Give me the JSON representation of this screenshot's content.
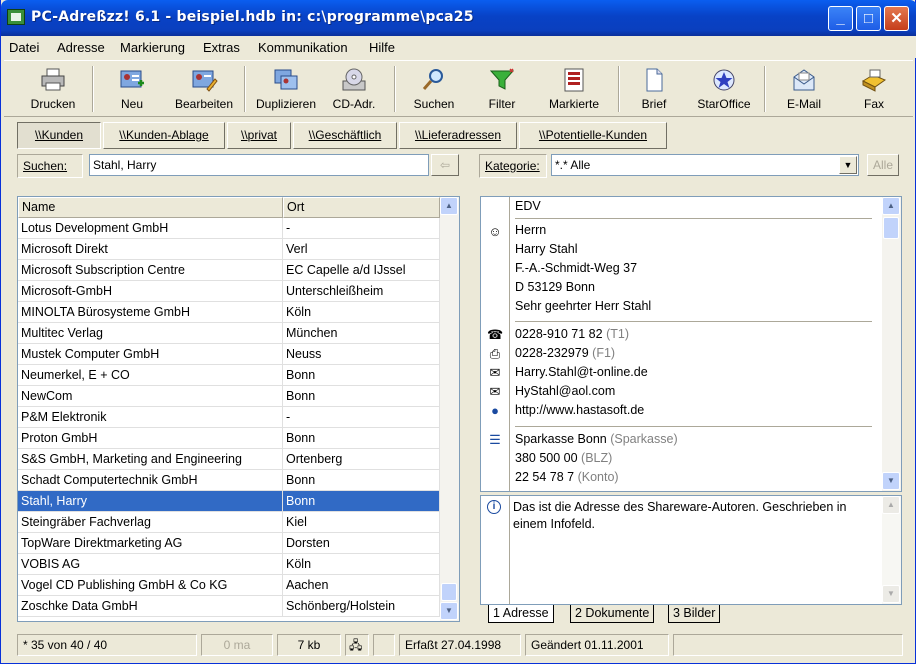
{
  "window": {
    "title": "PC-Adreßzz! 6.1 - beispiel.hdb in: c:\\programme\\pca25"
  },
  "menu": [
    "Datei",
    "Adresse",
    "Markierung",
    "Extras",
    "Kommunikation",
    "Hilfe"
  ],
  "toolbar": {
    "drucken": "Drucken",
    "neu": "Neu",
    "bearbeiten": "Bearbeiten",
    "duplizieren": "Duplizieren",
    "cdadr": "CD-Adr.",
    "suchen": "Suchen",
    "filter": "Filter",
    "markierte": "Markierte",
    "brief": "Brief",
    "staroffice": "StarOffice",
    "email": "E-Mail",
    "fax": "Fax"
  },
  "tabs": [
    "\\\\Kunden",
    "\\\\Kunden-Ablage",
    "\\\\privat",
    "\\\\Geschäftlich",
    "\\\\Lieferadressen",
    "\\\\Potentielle-Kunden"
  ],
  "search": {
    "label": "Suchen:",
    "value": "Stahl, Harry",
    "category_label": "Kategorie:",
    "category_value": "*.* Alle",
    "all_button": "Alle"
  },
  "list": {
    "headers": [
      "Name",
      "Ort"
    ],
    "rows": [
      [
        "Lotus Development GmbH",
        "-"
      ],
      [
        "Microsoft Direkt",
        "Verl"
      ],
      [
        "Microsoft Subscription Centre",
        "EC Capelle a/d IJssel"
      ],
      [
        "Microsoft-GmbH",
        "Unterschleißheim"
      ],
      [
        "MINOLTA Bürosysteme GmbH",
        "Köln"
      ],
      [
        "Multitec Verlag",
        "München"
      ],
      [
        "Mustek Computer GmbH",
        "Neuss"
      ],
      [
        "Neumerkel, E + CO",
        "Bonn"
      ],
      [
        "NewCom",
        "Bonn"
      ],
      [
        "P&M Elektronik",
        "-"
      ],
      [
        "Proton GmbH",
        "Bonn"
      ],
      [
        "S&S GmbH, Marketing and Engineering",
        "Ortenberg"
      ],
      [
        "Schadt Computertechnik GmbH",
        "Bonn"
      ],
      [
        "Stahl, Harry",
        "Bonn"
      ],
      [
        "Steingräber Fachverlag",
        "Kiel"
      ],
      [
        "TopWare Direktmarketing AG",
        "Dorsten"
      ],
      [
        "VOBIS AG",
        "Köln"
      ],
      [
        "Vogel CD Publishing GmbH & Co KG",
        "Aachen"
      ],
      [
        "Zoschke Data GmbH",
        "Schönberg/Holstein"
      ]
    ],
    "selected_index": 13
  },
  "detail": {
    "category": "EDV",
    "salutation": "Herrn",
    "name": "Harry Stahl",
    "street": "F.-A.-Schmidt-Weg 37",
    "city": "D 53129 Bonn",
    "greeting": "Sehr geehrter Herr Stahl",
    "phone": "0228-910 71 82",
    "phone_tag": "(T1)",
    "fax": "0228-232979",
    "fax_tag": "(F1)",
    "email1": "Harry.Stahl@t-online.de",
    "email2": "HyStahl@aol.com",
    "web": "http://www.hastasoft.de",
    "bank": "Sparkasse Bonn",
    "bank_tag": "(Sparkasse)",
    "blz": "380 500 00",
    "blz_tag": "(BLZ)",
    "konto": "22 54 78 7",
    "konto_tag": "(Konto)"
  },
  "info": {
    "text": "Das ist die Adresse des Shareware-Autoren. Geschrieben in einem Infofeld."
  },
  "bottom_tabs": [
    "1 Adresse",
    "2 Dokumente",
    "3 Bilder"
  ],
  "status": {
    "count": "* 35 von 40 / 40",
    "ma": "0 ma",
    "size": "7 kb",
    "created": "Erfaßt 27.04.1998",
    "changed": "Geändert 01.11.2001"
  }
}
